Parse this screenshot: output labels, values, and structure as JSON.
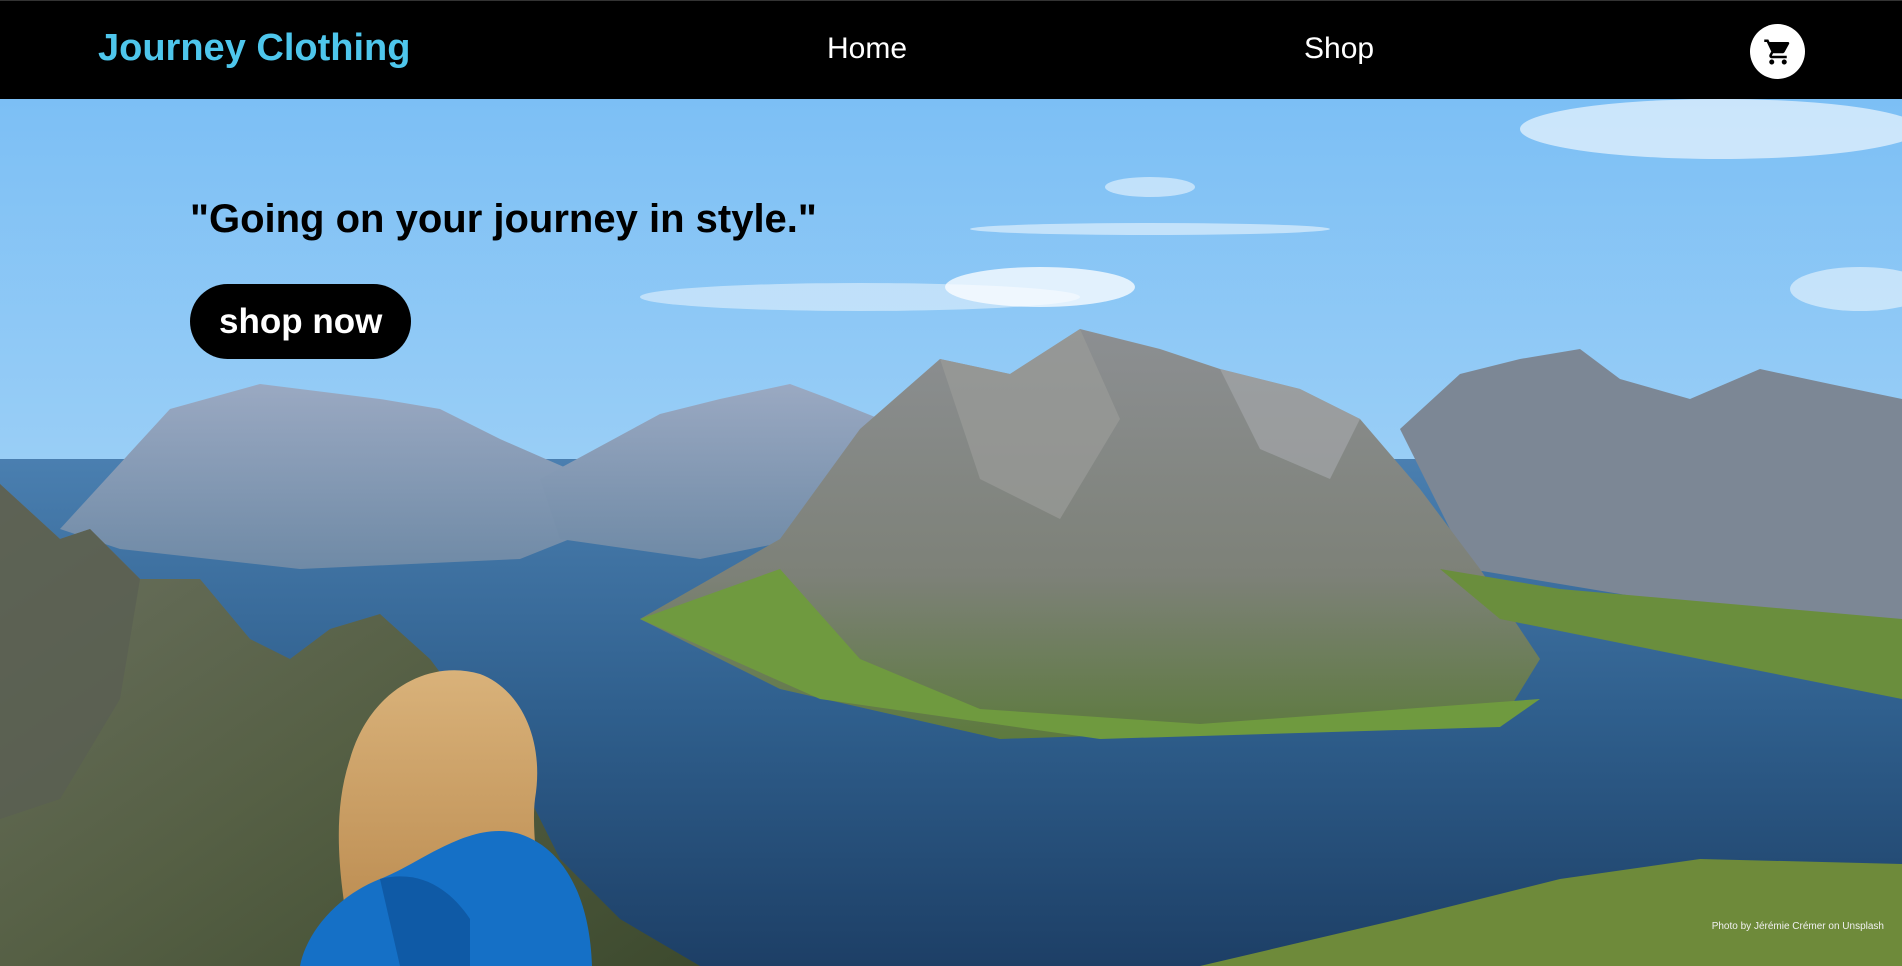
{
  "header": {
    "brand": "Journey Clothing",
    "nav": [
      {
        "label": "Home"
      },
      {
        "label": "Shop"
      }
    ],
    "cart_icon": "shopping-cart-icon"
  },
  "hero": {
    "tagline": "\"Going on your journey in style.\"",
    "cta_label": "shop now",
    "photo_credit": "Photo by Jérémie Crémer on Unsplash"
  },
  "colors": {
    "navbar_bg": "#000000",
    "brand": "#4ec6ec",
    "nav_text": "#ffffff",
    "cta_bg": "#000000",
    "cta_text": "#ffffff"
  }
}
